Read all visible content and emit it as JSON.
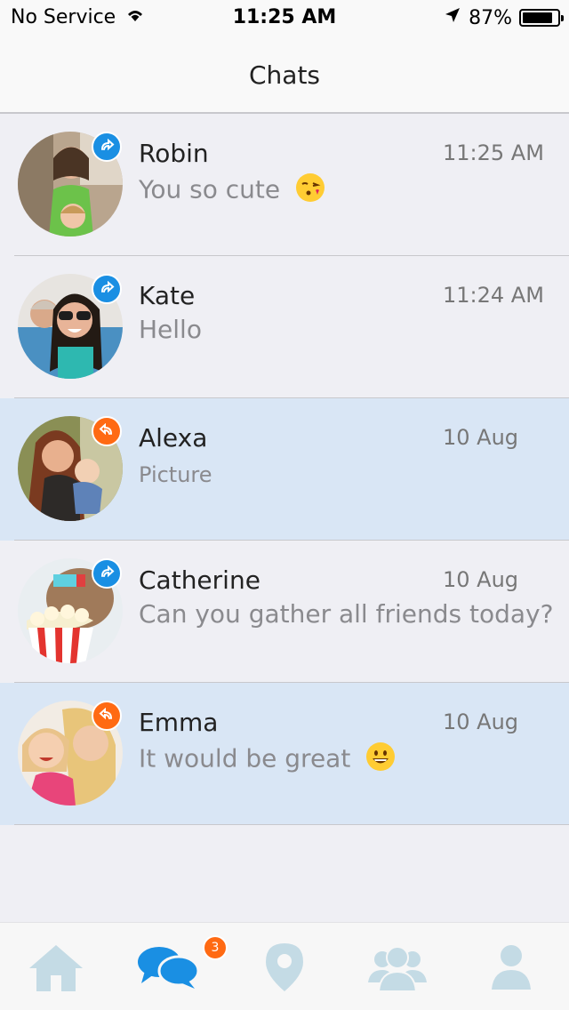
{
  "status_bar": {
    "carrier": "No Service",
    "time": "11:25 AM",
    "battery_percent": "87%",
    "battery_level": 0.87
  },
  "header": {
    "title": "Chats"
  },
  "chats": [
    {
      "name": "Robin",
      "time": "11:25 AM",
      "message": "You so cute",
      "emoji": "kissing-face-emoji",
      "status": "outgoing",
      "unread": false
    },
    {
      "name": "Kate",
      "time": "11:24 AM",
      "message": "Hello",
      "status": "outgoing",
      "unread": false
    },
    {
      "name": "Alexa",
      "time": "10 Aug",
      "message": "Picture",
      "status": "incoming",
      "unread": true
    },
    {
      "name": "Catherine",
      "time": "10 Aug",
      "message": "Can you gather all friends today?",
      "status": "outgoing",
      "unread": false
    },
    {
      "name": "Emma",
      "time": "10 Aug",
      "message": "It would be great",
      "emoji": "grinning-face-emoji",
      "status": "incoming",
      "unread": true
    }
  ],
  "tab_bar": {
    "tabs": [
      "home-icon",
      "chats-icon",
      "location-pin-icon",
      "friends-icon",
      "profile-icon"
    ],
    "chats_badge": "3"
  },
  "colors": {
    "outgoing": "#1a8fe3",
    "incoming": "#ff6a13",
    "unread_row": "#d9e6f5",
    "tab_active": "#1a8fe3",
    "tab_inactive": "#c4dbe5"
  }
}
